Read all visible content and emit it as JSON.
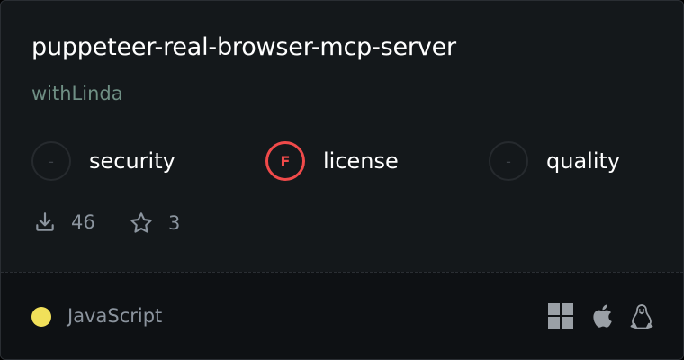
{
  "card": {
    "title": "puppeteer-real-browser-mcp-server",
    "author": "withLinda"
  },
  "scores": [
    {
      "label": "security",
      "badge": "-",
      "status": "none"
    },
    {
      "label": "license",
      "badge": "F",
      "status": "fail",
      "color": "#f04a4a"
    },
    {
      "label": "quality",
      "badge": "-",
      "status": "none"
    }
  ],
  "stats": {
    "downloads": "46",
    "stars": "3"
  },
  "footer": {
    "language": "JavaScript",
    "language_color": "#f1e05a",
    "platforms": [
      "windows-icon",
      "apple-icon",
      "linux-icon"
    ]
  }
}
